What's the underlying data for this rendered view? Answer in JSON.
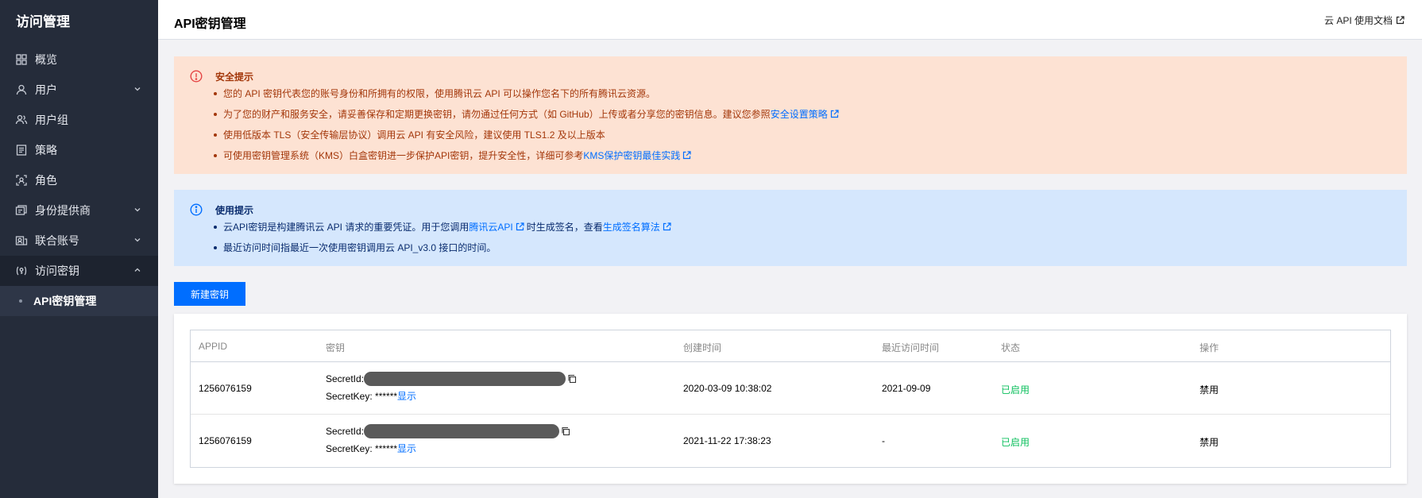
{
  "sidebar": {
    "title": "访问管理",
    "items": [
      {
        "label": "概览",
        "icon": "grid-icon",
        "expandable": false
      },
      {
        "label": "用户",
        "icon": "user-icon",
        "expandable": true
      },
      {
        "label": "用户组",
        "icon": "user-group-icon",
        "expandable": false
      },
      {
        "label": "策略",
        "icon": "policy-icon",
        "expandable": false
      },
      {
        "label": "角色",
        "icon": "role-icon",
        "expandable": false
      },
      {
        "label": "身份提供商",
        "icon": "identity-provider-icon",
        "expandable": true
      },
      {
        "label": "联合账号",
        "icon": "federated-account-icon",
        "expandable": true
      },
      {
        "label": "访问密钥",
        "icon": "key-icon",
        "expandable": true,
        "open": true
      }
    ],
    "subitem": "API密钥管理"
  },
  "header": {
    "title": "API密钥管理",
    "doc_link": "云 API 使用文档"
  },
  "security_notice": {
    "title": "安全提示",
    "line1": "您的 API 密钥代表您的账号身份和所拥有的权限，使用腾讯云 API 可以操作您名下的所有腾讯云资源。",
    "line2_pre": "为了您的财产和服务安全，请妥善保存和定期更换密钥，请勿通过任何方式（如 GitHub）上传或者分享您的密钥信息。建议您参照",
    "line2_link": "安全设置策略",
    "line3": "使用低版本 TLS（安全传输层协议）调用云 API 有安全风险，建议使用 TLS1.2 及以上版本",
    "line4_pre": "可使用密钥管理系统（KMS）白盒密钥进一步保护API密钥，提升安全性，详细可参考",
    "line4_link": "KMS保护密钥最佳实践"
  },
  "usage_notice": {
    "title": "使用提示",
    "line1_pre": "云API密钥是构建腾讯云 API 请求的重要凭证。用于您调用",
    "line1_link1": "腾讯云API",
    "line1_mid": "时生成签名，查看",
    "line1_link2": "生成签名算法",
    "line2": "最近访问时间指最近一次使用密钥调用云 API_v3.0 接口的时间。"
  },
  "create_button": "新建密钥",
  "table": {
    "headers": {
      "appid": "APPID",
      "secret": "密钥",
      "created": "创建时间",
      "last_access": "最近访问时间",
      "status": "状态",
      "action": "操作"
    },
    "secret_id_label": "SecretId:",
    "secret_key_label": "SecretKey: ******",
    "show_label": "显示",
    "rows": [
      {
        "appid": "1256076159",
        "created": "2020-03-09 10:38:02",
        "last_access": "2021-09-09",
        "status": "已启用",
        "action": "禁用"
      },
      {
        "appid": "1256076159",
        "created": "2021-11-22 17:38:23",
        "last_access": "-",
        "status": "已启用",
        "action": "禁用"
      }
    ]
  },
  "colors": {
    "sidebar_bg": "#252c3a",
    "primary": "#006eff",
    "warning_bg": "#fde2d3",
    "info_bg": "#d5e7fd",
    "status_green": "#0abf5b"
  }
}
